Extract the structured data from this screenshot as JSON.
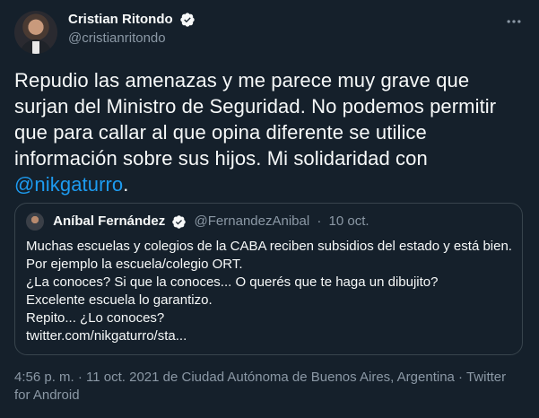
{
  "author": {
    "name": "Cristian Ritondo",
    "handle": "@cristianritondo",
    "verified_icon": "verified-badge-icon"
  },
  "tweet": {
    "text_before_mention": "Repudio las amenazas y me parece muy grave que surjan del Ministro de Seguridad. No podemos permitir que para callar al que opina diferente se utilice información sobre sus hijos. Mi solidaridad con ",
    "mention": "@nikgaturro",
    "text_after_mention": "."
  },
  "quote": {
    "name": "Aníbal Fernández",
    "handle": "@FernandezAnibal",
    "separator": "·",
    "date": "10 oct.",
    "lines": [
      "Muchas escuelas y colegios de la CABA reciben subsidios del estado y está bien.",
      "Por ejemplo la escuela/colegio ORT.",
      "¿La conoces? Si que la conoces... O querés que te haga un dibujito?",
      "Excelente escuela lo garantizo.",
      "Repito... ¿Lo conoces?",
      "twitter.com/nikgaturro/sta..."
    ]
  },
  "meta": {
    "text": "4:56 p. m. · 11 oct. 2021 de Ciudad Autónoma de Buenos Aires, Argentina · Twitter for Android"
  },
  "colors": {
    "background": "#15202b",
    "accent": "#1d9bf0",
    "secondary_text": "#8b98a5",
    "border": "#38444d"
  }
}
